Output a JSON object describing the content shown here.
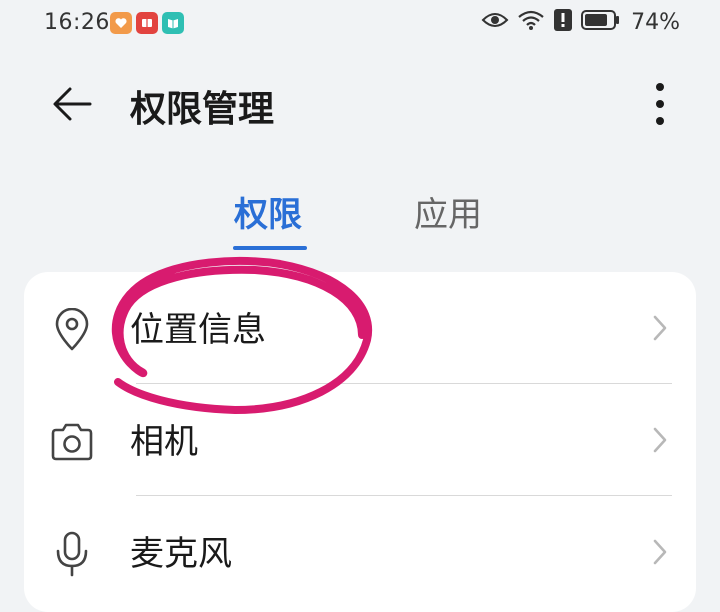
{
  "status_bar": {
    "time": "16:26",
    "battery": "74%",
    "icons": [
      "eye-icon",
      "wifi-icon",
      "alert-icon",
      "battery-icon"
    ],
    "app_badges": [
      "heart-app-icon",
      "book-app-icon",
      "reader-app-icon"
    ]
  },
  "header": {
    "title": "权限管理",
    "back_icon": "arrow-left-icon",
    "more_icon": "more-vertical-icon"
  },
  "tabs": [
    {
      "label": "权限",
      "active": true
    },
    {
      "label": "应用",
      "active": false
    }
  ],
  "list": {
    "items": [
      {
        "label": "位置信息",
        "icon": "location-pin-icon"
      },
      {
        "label": "相机",
        "icon": "camera-icon"
      },
      {
        "label": "麦克风",
        "icon": "microphone-icon"
      }
    ]
  },
  "colors": {
    "accent": "#2a6fd6",
    "annotation": "#d81b6f",
    "background": "#f1f3f5",
    "card": "#ffffff"
  }
}
